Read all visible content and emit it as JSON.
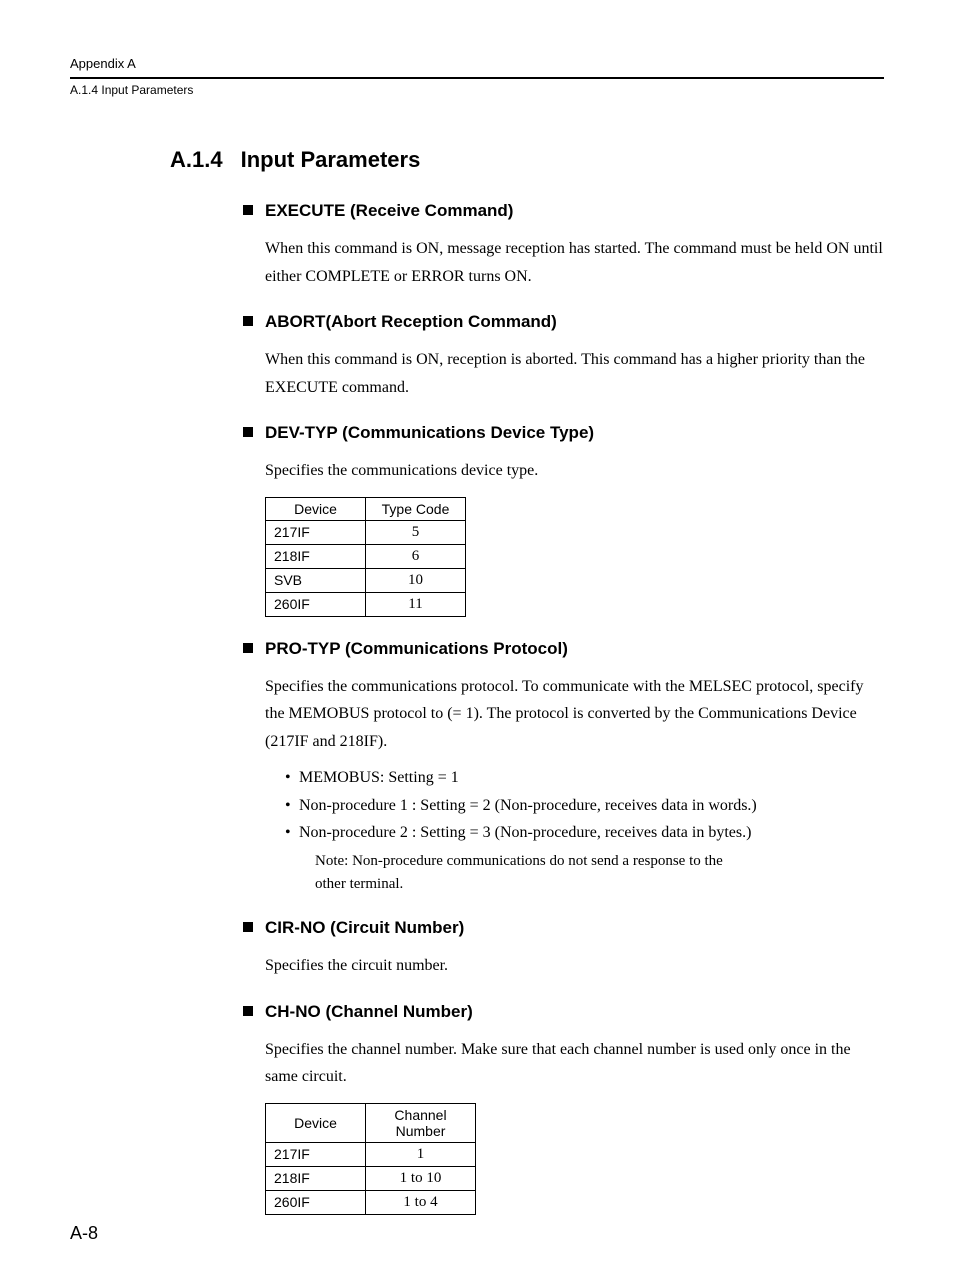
{
  "header": {
    "appendix": "Appendix A",
    "section": "A.1.4  Input Parameters"
  },
  "heading": {
    "number": "A.1.4",
    "title": "Input Parameters"
  },
  "sub_execute": {
    "title": "EXECUTE (Receive Command)",
    "body": "When this command is ON, message reception has started. The command must be held ON until either COMPLETE or ERROR turns ON."
  },
  "sub_abort": {
    "title": "ABORT(Abort Reception Command)",
    "body": "When this command is ON, reception is aborted. This command has a higher priority than the EXECUTE command."
  },
  "sub_devtyp": {
    "title": "DEV-TYP (Communications Device Type)",
    "body": "Specifies the communications device type.",
    "table_headers": [
      "Device",
      "Type Code"
    ],
    "rows": [
      {
        "device": "217IF",
        "code": "5"
      },
      {
        "device": "218IF",
        "code": "6"
      },
      {
        "device": "SVB",
        "code": "10"
      },
      {
        "device": "260IF",
        "code": "11"
      }
    ]
  },
  "sub_protyp": {
    "title": "PRO-TYP (Communications Protocol)",
    "body": "Specifies the communications protocol. To communicate with the MELSEC protocol, specify the MEMOBUS protocol to (= 1). The protocol is converted by the Communications Device (217IF and 218IF).",
    "bullets": [
      "MEMOBUS: Setting = 1",
      "Non-procedure 1 : Setting = 2 (Non-procedure, receives data in words.)",
      "Non-procedure 2 : Setting = 3 (Non-procedure, receives data in bytes.)"
    ],
    "note_label": "Note:",
    "note_body": "Non-procedure communications do not send a response to the other terminal."
  },
  "sub_cirno": {
    "title": "CIR-NO (Circuit Number)",
    "body": "Specifies the circuit number."
  },
  "sub_chno": {
    "title": "CH-NO (Channel Number)",
    "body": "Specifies the channel number. Make sure that each channel number is used only once in the same circuit.",
    "table_headers": [
      "Device",
      "Channel Number"
    ],
    "rows": [
      {
        "device": "217IF",
        "channel": "1"
      },
      {
        "device": "218IF",
        "channel": "1 to 10"
      },
      {
        "device": "260IF",
        "channel": "1 to 4"
      }
    ]
  },
  "page_number": "A-8"
}
